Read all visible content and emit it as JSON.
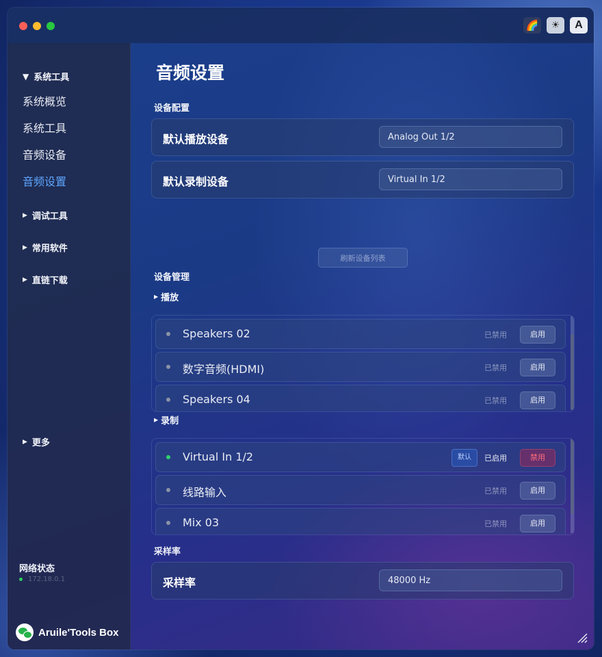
{
  "window": {
    "top_icons": [
      {
        "name": "rainbow-theme-icon",
        "glyph": "🌈"
      },
      {
        "name": "brightness-icon",
        "glyph": "☀"
      },
      {
        "name": "font-icon",
        "glyph": "A"
      }
    ]
  },
  "sidebar": {
    "groups": [
      {
        "label": "系统工具",
        "expanded": true
      },
      {
        "label": "调试工具",
        "expanded": false
      },
      {
        "label": "常用软件",
        "expanded": false
      },
      {
        "label": "直链下载",
        "expanded": false
      },
      {
        "label": "更多",
        "expanded": false
      }
    ],
    "items": [
      {
        "label": "系统概览"
      },
      {
        "label": "系统工具"
      },
      {
        "label": "音频设备"
      },
      {
        "label": "音频设置",
        "active": true
      }
    ],
    "network": {
      "title": "网络状态",
      "ip": "172.18.0.1"
    },
    "brand": "Aruile'Tools Box"
  },
  "main": {
    "title": "音频设置",
    "device_config": {
      "section": "设备配置",
      "playback": {
        "label": "默认播放设备",
        "value": "Analog Out 1/2"
      },
      "record": {
        "label": "默认录制设备",
        "value": "Virtual In 1/2"
      }
    },
    "refresh_label": "刷新设备列表",
    "device_mgmt": {
      "section": "设备管理",
      "playback_label": "播放",
      "playback_devices": [
        {
          "name": "Speakers 02",
          "status": "已禁用",
          "action": "启用",
          "enabled": false
        },
        {
          "name": "数字音频(HDMI)",
          "status": "已禁用",
          "action": "启用",
          "enabled": false
        },
        {
          "name": "Speakers 04",
          "status": "已禁用",
          "action": "启用",
          "enabled": false
        }
      ],
      "record_label": "录制",
      "record_devices": [
        {
          "name": "Virtual In 1/2",
          "badge": "默认",
          "status": "已启用",
          "action": "禁用",
          "enabled": true
        },
        {
          "name": "线路输入",
          "status": "已禁用",
          "action": "启用",
          "enabled": false
        },
        {
          "name": "Mix 03",
          "status": "已禁用",
          "action": "启用",
          "enabled": false
        }
      ]
    },
    "sample_rate": {
      "section": "采样率",
      "label": "采样率",
      "value": "48000 Hz"
    }
  },
  "colors": {
    "accent": "#5ea6ff",
    "enabled_dot": "#2ed36a",
    "disable_text": "#ff6b7a"
  }
}
